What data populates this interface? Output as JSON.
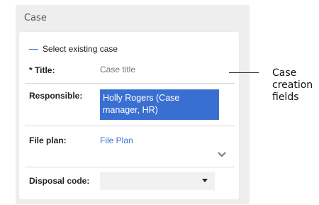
{
  "panel": {
    "title": "Case"
  },
  "form": {
    "select_existing_label": "Select existing case",
    "title_label": "* Title:",
    "title_placeholder": "Case title",
    "title_value": "",
    "responsible_label": "Responsible:",
    "responsible_value": "Holly Rogers (Case manager, HR)",
    "file_plan_label": "File plan:",
    "file_plan_link": "File Plan",
    "disposal_code_label": "Disposal code:",
    "disposal_code_value": ""
  },
  "callout": {
    "lines": [
      "Case",
      "creation",
      "fields"
    ]
  },
  "colors": {
    "accent": "#3b73d1",
    "selected_bg": "#3a6fd2",
    "panel_bg": "#eeeeee"
  }
}
